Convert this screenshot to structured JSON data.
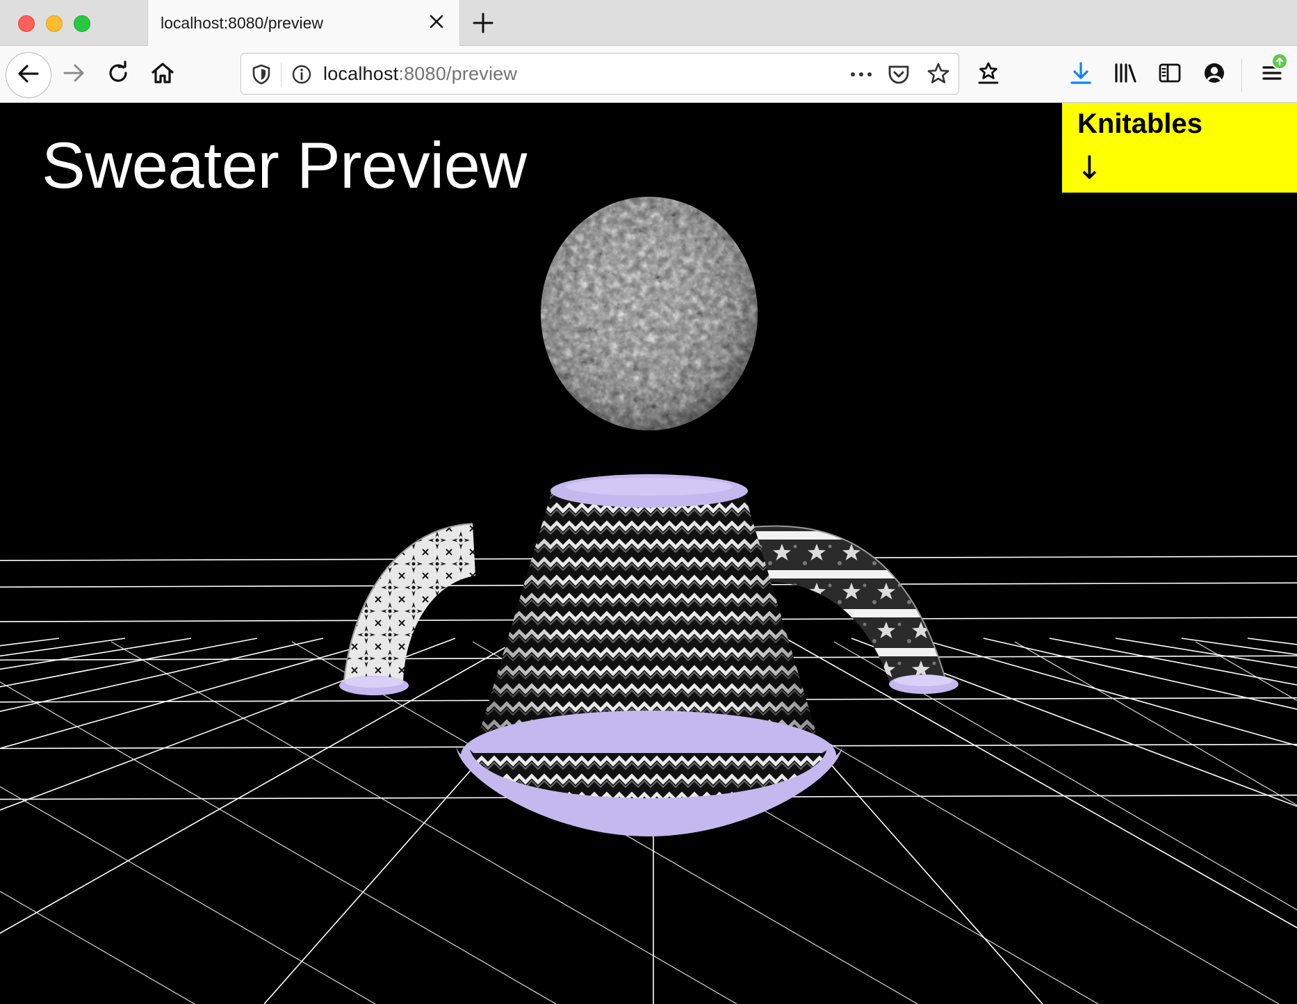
{
  "browser": {
    "tab_title": "localhost:8080/preview",
    "url_host": "localhost",
    "url_path": ":8080/preview",
    "icons": [
      "back-arrow-icon",
      "forward-arrow-icon",
      "reload-icon",
      "home-icon",
      "shield-icon",
      "info-icon",
      "more-icon",
      "pocket-icon",
      "star-icon",
      "star-list-icon",
      "download-icon",
      "library-icon",
      "sidebar-icon",
      "account-icon",
      "menu-icon",
      "update-badge-icon"
    ],
    "colors": {
      "tab_bar": "#dedede",
      "toolbar": "#f9f9f9",
      "download_icon": "#0a84ff",
      "update_badge": "#5fc94a"
    }
  },
  "page": {
    "title": "Sweater Preview",
    "brand": "Knitables",
    "brand_arrow": "↓",
    "colors": {
      "background": "#000000",
      "brand_box": "#ffff00",
      "trim": "#c4b8ee",
      "grid": "#ffffff"
    }
  }
}
